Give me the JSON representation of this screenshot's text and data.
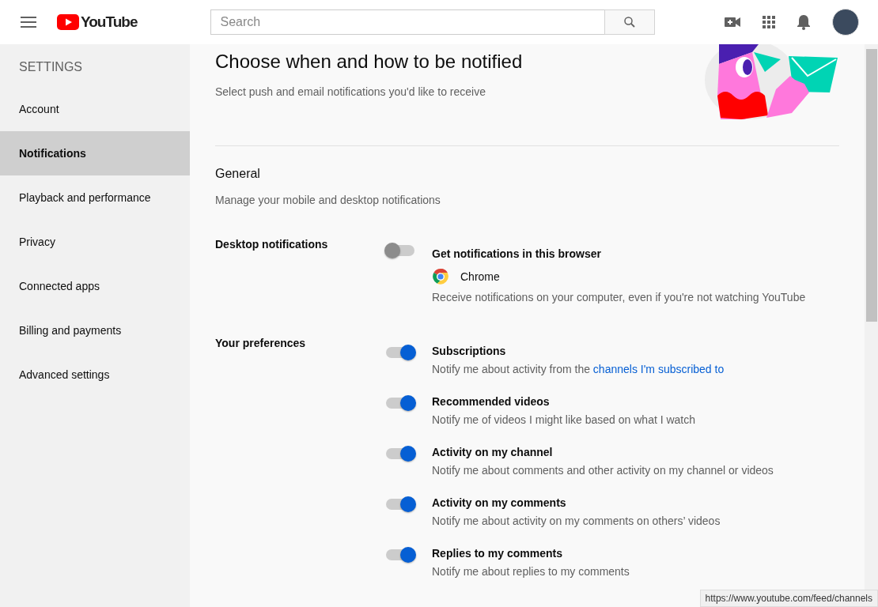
{
  "header": {
    "logo": "YouTube",
    "search": {
      "placeholder": "Search"
    }
  },
  "sidebar": {
    "title": "SETTINGS",
    "items": [
      {
        "label": "Account",
        "selected": false
      },
      {
        "label": "Notifications",
        "selected": true
      },
      {
        "label": "Playback and performance",
        "selected": false
      },
      {
        "label": "Privacy",
        "selected": false
      },
      {
        "label": "Connected apps",
        "selected": false
      },
      {
        "label": "Billing and payments",
        "selected": false
      },
      {
        "label": "Advanced settings",
        "selected": false
      }
    ]
  },
  "page": {
    "title": "Choose when and how to be notified",
    "subtitle": "Select push and email notifications you'd like to receive"
  },
  "general": {
    "title": "General",
    "description": "Manage your mobile and desktop notifications"
  },
  "desktop": {
    "label": "Desktop notifications",
    "on": false,
    "title": "Get notifications in this browser",
    "browser": "Chrome",
    "description": "Receive notifications on your computer, even if you're not watching YouTube"
  },
  "preferences": {
    "label": "Your preferences",
    "items": [
      {
        "title": "Subscriptions",
        "on": true,
        "description": "Notify me about activity from the",
        "link": "channels I'm subscribed to"
      },
      {
        "title": "Recommended videos",
        "on": true,
        "description": "Notify me of videos I might like based on what I watch"
      },
      {
        "title": "Activity on my channel",
        "on": true,
        "description": "Notify me about comments and other activity on my channel or videos"
      },
      {
        "title": "Activity on my comments",
        "on": true,
        "description": "Notify me about activity on my comments on others’ videos"
      },
      {
        "title": "Replies to my comments",
        "on": true,
        "description": "Notify me about replies to my comments"
      }
    ]
  },
  "status_bar": {
    "url": "https://www.youtube.com/feed/channels"
  }
}
